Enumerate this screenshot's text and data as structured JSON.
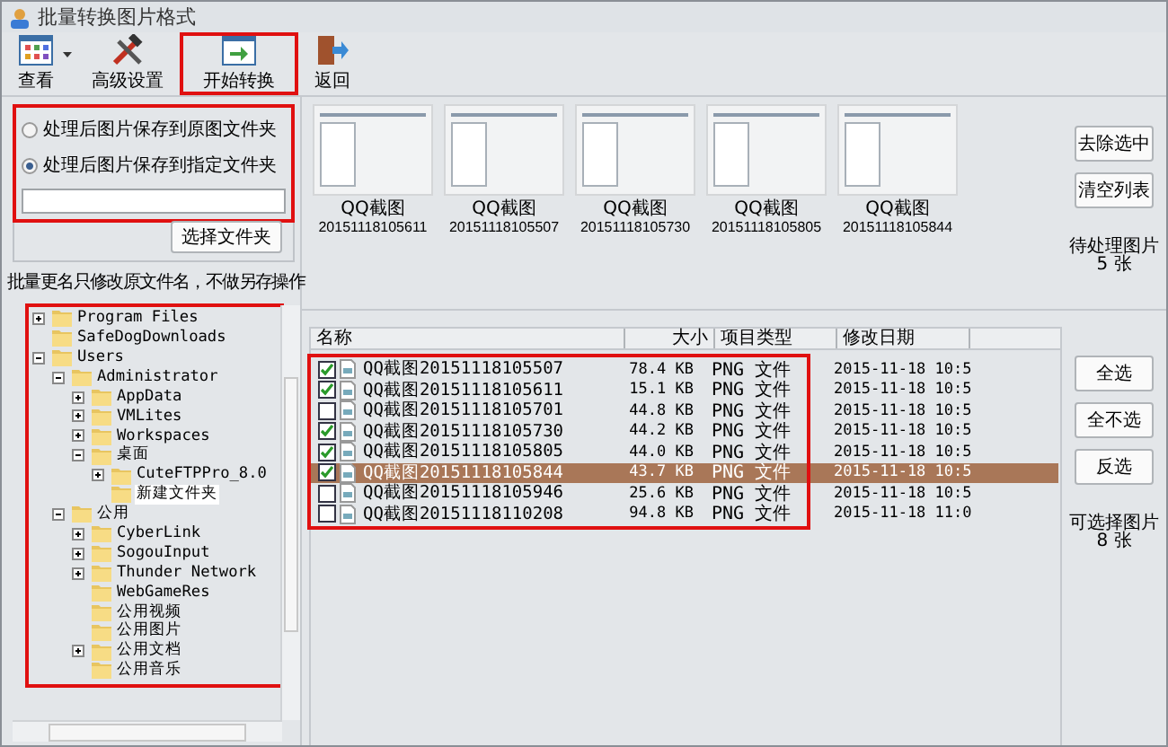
{
  "window": {
    "title": "批量转换图片格式"
  },
  "toolbar": [
    {
      "label": "查看",
      "dropdown": true,
      "highlighted": false
    },
    {
      "label": "高级设置",
      "dropdown": false,
      "highlighted": false
    },
    {
      "label": "开始转换",
      "dropdown": false,
      "highlighted": true
    },
    {
      "label": "返回",
      "dropdown": false,
      "highlighted": false
    }
  ],
  "save_options": {
    "highlighted": true,
    "radios": [
      {
        "label": "处理后图片保存到原图文件夹",
        "selected": false
      },
      {
        "label": "处理后图片保存到指定文件夹",
        "selected": true
      }
    ],
    "button": "选择文件夹"
  },
  "note": "批量更名只修改原文件名，不做另存操作",
  "tree": {
    "highlighted": true,
    "items": [
      {
        "label": "Program Files",
        "expanded": false,
        "selected": false
      },
      {
        "label": "SafeDogDownloads",
        "selected": false
      },
      {
        "label": "Users",
        "expanded": true,
        "selected": false,
        "children": [
          {
            "label": "Administrator",
            "expanded": true,
            "selected": false,
            "children": [
              {
                "label": "AppData",
                "expanded": false,
                "selected": false
              },
              {
                "label": "VMLites",
                "expanded": false,
                "selected": false
              },
              {
                "label": "Workspaces",
                "expanded": false,
                "selected": false
              },
              {
                "label": "桌面",
                "expanded": true,
                "selected": false,
                "children": [
                  {
                    "label": "CuteFTPPro_8.0",
                    "expanded": false,
                    "selected": false
                  },
                  {
                    "label": "新建文件夹",
                    "selected": true
                  }
                ]
              }
            ]
          },
          {
            "label": "公用",
            "expanded": true,
            "selected": false,
            "children": [
              {
                "label": "CyberLink",
                "expanded": false,
                "selected": false
              },
              {
                "label": "SogouInput",
                "expanded": false,
                "selected": false
              },
              {
                "label": "Thunder Network",
                "expanded": false,
                "selected": false
              },
              {
                "label": "WebGameRes",
                "selected": false
              },
              {
                "label": "公用视频",
                "selected": false
              },
              {
                "label": "公用图片",
                "selected": false
              },
              {
                "label": "公用文档",
                "expanded": false,
                "selected": false
              },
              {
                "label": "公用音乐",
                "selected": false
              }
            ]
          }
        ]
      }
    ]
  },
  "thumbnails": [
    {
      "name": "QQ截图",
      "date": "20151118105611"
    },
    {
      "name": "QQ截图",
      "date": "20151118105507"
    },
    {
      "name": "QQ截图",
      "date": "20151118105730"
    },
    {
      "name": "QQ截图",
      "date": "20151118105805"
    },
    {
      "name": "QQ截图",
      "date": "20151118105844"
    }
  ],
  "queue_buttons": [
    "去除选中",
    "清空列表"
  ],
  "queue_count": {
    "label": "待处理图片",
    "count": "5 张"
  },
  "file_table": {
    "highlighted": true,
    "columns": [
      "名称",
      "大小",
      "项目类型",
      "修改日期"
    ],
    "rows": [
      {
        "name": "QQ截图20151118105507",
        "size": "78.4 KB",
        "type": "PNG 文件",
        "date": "2015-11-18 10:5",
        "checked": true,
        "selected": false
      },
      {
        "name": "QQ截图20151118105611",
        "size": "15.1 KB",
        "type": "PNG 文件",
        "date": "2015-11-18 10:5",
        "checked": true,
        "selected": false
      },
      {
        "name": "QQ截图20151118105701",
        "size": "44.8 KB",
        "type": "PNG 文件",
        "date": "2015-11-18 10:5",
        "checked": false,
        "selected": false
      },
      {
        "name": "QQ截图20151118105730",
        "size": "44.2 KB",
        "type": "PNG 文件",
        "date": "2015-11-18 10:5",
        "checked": true,
        "selected": false
      },
      {
        "name": "QQ截图20151118105805",
        "size": "44.0 KB",
        "type": "PNG 文件",
        "date": "2015-11-18 10:5",
        "checked": true,
        "selected": false
      },
      {
        "name": "QQ截图20151118105844",
        "size": "43.7 KB",
        "type": "PNG 文件",
        "date": "2015-11-18 10:5",
        "checked": true,
        "selected": true
      },
      {
        "name": "QQ截图20151118105946",
        "size": "25.6 KB",
        "type": "PNG 文件",
        "date": "2015-11-18 10:5",
        "checked": false,
        "selected": false
      },
      {
        "name": "QQ截图20151118110208",
        "size": "94.8 KB",
        "type": "PNG 文件",
        "date": "2015-11-18 11:0",
        "checked": false,
        "selected": false
      }
    ]
  },
  "select_buttons": [
    "全选",
    "全不选",
    "反选"
  ],
  "selectable_count": {
    "label": "可选择图片",
    "count": "8 张"
  }
}
